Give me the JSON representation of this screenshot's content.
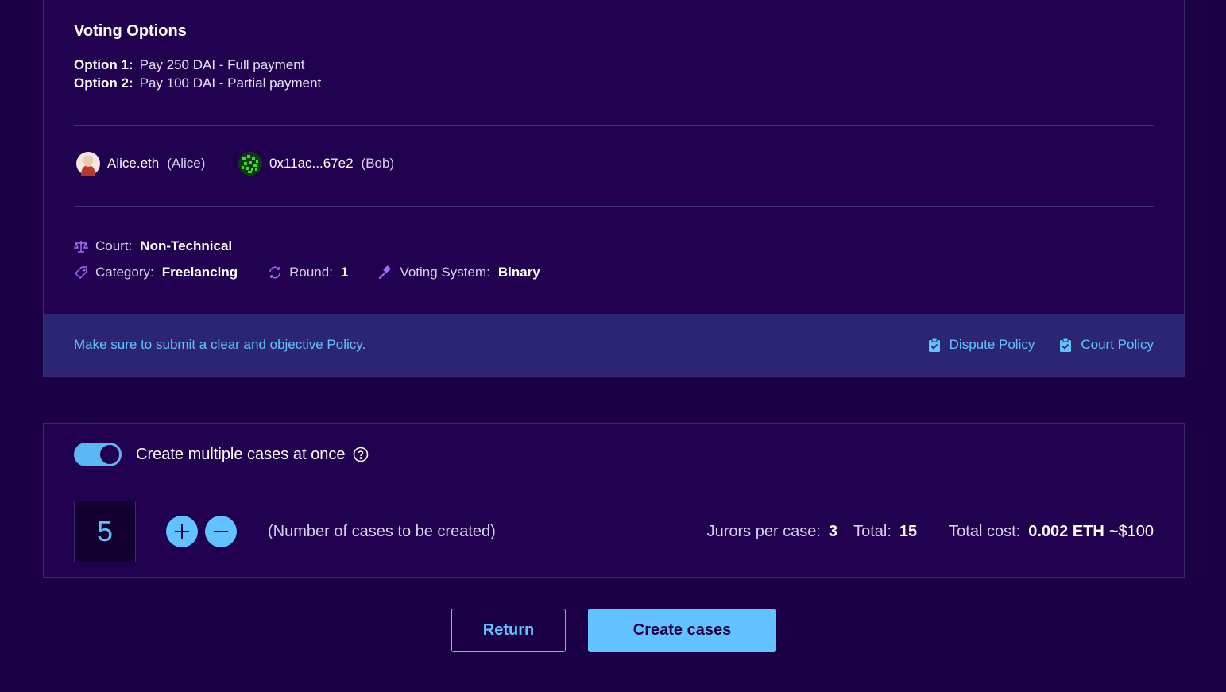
{
  "voting": {
    "title": "Voting Options",
    "options": [
      {
        "label": "Option 1:",
        "text": "Pay 250 DAI - Full payment"
      },
      {
        "label": "Option 2:",
        "text": "Pay 100 DAI - Partial payment"
      }
    ]
  },
  "parties": [
    {
      "name": "Alice.eth",
      "alias": "(Alice)",
      "avatar": "alice-avatar"
    },
    {
      "name": "0x11ac...67e2",
      "alias": "(Bob)",
      "avatar": "identicon-avatar"
    }
  ],
  "meta": {
    "court_label": "Court:",
    "court_value": "Non-Technical",
    "category_label": "Category:",
    "category_value": "Freelancing",
    "round_label": "Round:",
    "round_value": "1",
    "voting_system_label": "Voting System:",
    "voting_system_value": "Binary"
  },
  "policy": {
    "message": "Make sure to submit a clear and objective Policy.",
    "dispute_policy": "Dispute Policy",
    "court_policy": "Court Policy"
  },
  "cases": {
    "toggle_label": "Create multiple cases at once",
    "toggle_on": true,
    "count": "5",
    "count_hint": "(Number of cases to be created)",
    "jurors_label": "Jurors per case:",
    "jurors_value": "3",
    "total_label": "Total:",
    "total_value": "15",
    "cost_label": "Total cost:",
    "cost_value": "0.002 ETH",
    "cost_usd": "~$100"
  },
  "actions": {
    "return_label": "Return",
    "create_label": "Create cases"
  },
  "colors": {
    "background": "#1c0046",
    "card": "#220050",
    "accent": "#62c2ff",
    "icon_purple": "#a46cf5"
  }
}
